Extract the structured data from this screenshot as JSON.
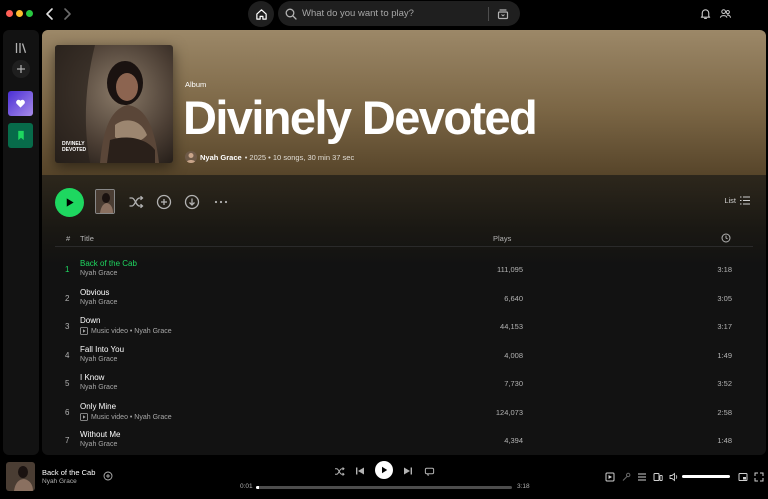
{
  "search": {
    "placeholder": "What do you want to play?"
  },
  "album": {
    "type_label": "Album",
    "title": "Divinely Devoted",
    "artist": "Nyah Grace",
    "info": "• 2025 • 10 songs, 30 min 37 sec",
    "cover_text_line1": "DIVINELY",
    "cover_text_line2": "DEVOTED"
  },
  "view": {
    "list_label": "List"
  },
  "table": {
    "headers": {
      "num": "#",
      "title": "Title",
      "plays": "Plays"
    },
    "tracks": [
      {
        "num": "1",
        "title": "Back of the Cab",
        "artist": "Nyah Grace",
        "music_video": false,
        "plays": "111,095",
        "duration": "3:18",
        "active": true
      },
      {
        "num": "2",
        "title": "Obvious",
        "artist": "Nyah Grace",
        "music_video": false,
        "plays": "6,640",
        "duration": "3:05",
        "active": false
      },
      {
        "num": "3",
        "title": "Down",
        "artist": "Music video • Nyah Grace",
        "music_video": true,
        "plays": "44,153",
        "duration": "3:17",
        "active": false
      },
      {
        "num": "4",
        "title": "Fall Into You",
        "artist": "Nyah Grace",
        "music_video": false,
        "plays": "4,008",
        "duration": "1:49",
        "active": false
      },
      {
        "num": "5",
        "title": "I Know",
        "artist": "Nyah Grace",
        "music_video": false,
        "plays": "7,730",
        "duration": "3:52",
        "active": false
      },
      {
        "num": "6",
        "title": "Only Mine",
        "artist": "Music video • Nyah Grace",
        "music_video": true,
        "plays": "124,073",
        "duration": "2:58",
        "active": false
      },
      {
        "num": "7",
        "title": "Without Me",
        "artist": "Nyah Grace",
        "music_video": false,
        "plays": "4,394",
        "duration": "1:48",
        "active": false
      }
    ]
  },
  "now_playing": {
    "title": "Back of the Cab",
    "artist": "Nyah Grace",
    "elapsed": "0:01",
    "total": "3:18",
    "progress_percent": 1,
    "volume_percent": 100
  },
  "colors": {
    "accent_green": "#1ed760",
    "hero_top": "#9c8868",
    "background": "#121212"
  },
  "icons": {
    "sidebar": [
      "library-icon",
      "plus-icon",
      "liked-songs-heart-icon",
      "saved-bookmark-icon"
    ],
    "actions": [
      "shuffle-icon",
      "add-circle-icon",
      "download-icon",
      "more-icon"
    ]
  }
}
